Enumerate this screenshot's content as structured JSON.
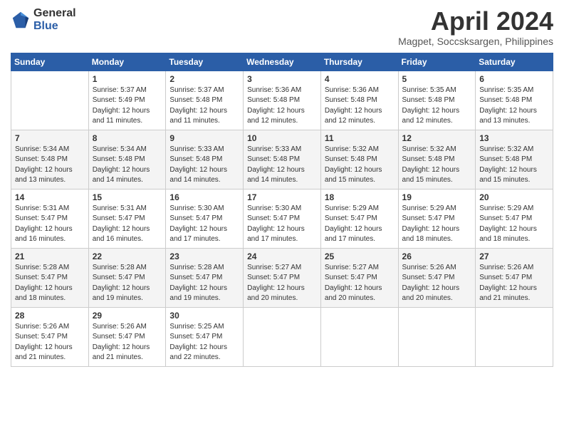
{
  "logo": {
    "general": "General",
    "blue": "Blue"
  },
  "header": {
    "month": "April 2024",
    "location": "Magpet, Soccsksargen, Philippines"
  },
  "weekdays": [
    "Sunday",
    "Monday",
    "Tuesday",
    "Wednesday",
    "Thursday",
    "Friday",
    "Saturday"
  ],
  "weeks": [
    [
      {
        "day": "",
        "info": ""
      },
      {
        "day": "1",
        "info": "Sunrise: 5:37 AM\nSunset: 5:49 PM\nDaylight: 12 hours\nand 11 minutes."
      },
      {
        "day": "2",
        "info": "Sunrise: 5:37 AM\nSunset: 5:48 PM\nDaylight: 12 hours\nand 11 minutes."
      },
      {
        "day": "3",
        "info": "Sunrise: 5:36 AM\nSunset: 5:48 PM\nDaylight: 12 hours\nand 12 minutes."
      },
      {
        "day": "4",
        "info": "Sunrise: 5:36 AM\nSunset: 5:48 PM\nDaylight: 12 hours\nand 12 minutes."
      },
      {
        "day": "5",
        "info": "Sunrise: 5:35 AM\nSunset: 5:48 PM\nDaylight: 12 hours\nand 12 minutes."
      },
      {
        "day": "6",
        "info": "Sunrise: 5:35 AM\nSunset: 5:48 PM\nDaylight: 12 hours\nand 13 minutes."
      }
    ],
    [
      {
        "day": "7",
        "info": "Sunrise: 5:34 AM\nSunset: 5:48 PM\nDaylight: 12 hours\nand 13 minutes."
      },
      {
        "day": "8",
        "info": "Sunrise: 5:34 AM\nSunset: 5:48 PM\nDaylight: 12 hours\nand 14 minutes."
      },
      {
        "day": "9",
        "info": "Sunrise: 5:33 AM\nSunset: 5:48 PM\nDaylight: 12 hours\nand 14 minutes."
      },
      {
        "day": "10",
        "info": "Sunrise: 5:33 AM\nSunset: 5:48 PM\nDaylight: 12 hours\nand 14 minutes."
      },
      {
        "day": "11",
        "info": "Sunrise: 5:32 AM\nSunset: 5:48 PM\nDaylight: 12 hours\nand 15 minutes."
      },
      {
        "day": "12",
        "info": "Sunrise: 5:32 AM\nSunset: 5:48 PM\nDaylight: 12 hours\nand 15 minutes."
      },
      {
        "day": "13",
        "info": "Sunrise: 5:32 AM\nSunset: 5:48 PM\nDaylight: 12 hours\nand 15 minutes."
      }
    ],
    [
      {
        "day": "14",
        "info": "Sunrise: 5:31 AM\nSunset: 5:47 PM\nDaylight: 12 hours\nand 16 minutes."
      },
      {
        "day": "15",
        "info": "Sunrise: 5:31 AM\nSunset: 5:47 PM\nDaylight: 12 hours\nand 16 minutes."
      },
      {
        "day": "16",
        "info": "Sunrise: 5:30 AM\nSunset: 5:47 PM\nDaylight: 12 hours\nand 17 minutes."
      },
      {
        "day": "17",
        "info": "Sunrise: 5:30 AM\nSunset: 5:47 PM\nDaylight: 12 hours\nand 17 minutes."
      },
      {
        "day": "18",
        "info": "Sunrise: 5:29 AM\nSunset: 5:47 PM\nDaylight: 12 hours\nand 17 minutes."
      },
      {
        "day": "19",
        "info": "Sunrise: 5:29 AM\nSunset: 5:47 PM\nDaylight: 12 hours\nand 18 minutes."
      },
      {
        "day": "20",
        "info": "Sunrise: 5:29 AM\nSunset: 5:47 PM\nDaylight: 12 hours\nand 18 minutes."
      }
    ],
    [
      {
        "day": "21",
        "info": "Sunrise: 5:28 AM\nSunset: 5:47 PM\nDaylight: 12 hours\nand 18 minutes."
      },
      {
        "day": "22",
        "info": "Sunrise: 5:28 AM\nSunset: 5:47 PM\nDaylight: 12 hours\nand 19 minutes."
      },
      {
        "day": "23",
        "info": "Sunrise: 5:28 AM\nSunset: 5:47 PM\nDaylight: 12 hours\nand 19 minutes."
      },
      {
        "day": "24",
        "info": "Sunrise: 5:27 AM\nSunset: 5:47 PM\nDaylight: 12 hours\nand 20 minutes."
      },
      {
        "day": "25",
        "info": "Sunrise: 5:27 AM\nSunset: 5:47 PM\nDaylight: 12 hours\nand 20 minutes."
      },
      {
        "day": "26",
        "info": "Sunrise: 5:26 AM\nSunset: 5:47 PM\nDaylight: 12 hours\nand 20 minutes."
      },
      {
        "day": "27",
        "info": "Sunrise: 5:26 AM\nSunset: 5:47 PM\nDaylight: 12 hours\nand 21 minutes."
      }
    ],
    [
      {
        "day": "28",
        "info": "Sunrise: 5:26 AM\nSunset: 5:47 PM\nDaylight: 12 hours\nand 21 minutes."
      },
      {
        "day": "29",
        "info": "Sunrise: 5:26 AM\nSunset: 5:47 PM\nDaylight: 12 hours\nand 21 minutes."
      },
      {
        "day": "30",
        "info": "Sunrise: 5:25 AM\nSunset: 5:47 PM\nDaylight: 12 hours\nand 22 minutes."
      },
      {
        "day": "",
        "info": ""
      },
      {
        "day": "",
        "info": ""
      },
      {
        "day": "",
        "info": ""
      },
      {
        "day": "",
        "info": ""
      }
    ]
  ]
}
